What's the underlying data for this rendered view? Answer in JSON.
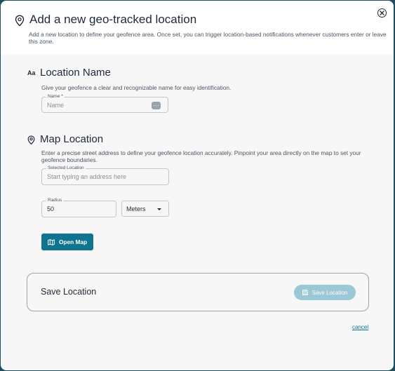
{
  "modal": {
    "title": "Add a new geo-tracked location",
    "description": "Add a new location to define your geofence area. Once set, you can trigger location-based notifications whenever customers enter or leave this zone."
  },
  "location_name": {
    "icon_text": "Aa",
    "title": "Location Name",
    "description": "Give your geofence a clear and recognizable name for easy identification.",
    "name_label": "Name *",
    "name_placeholder": "Name"
  },
  "map_location": {
    "title": "Map Location",
    "description": "Enter a precise street address to define your geofence location accurately. Pinpoint your area directly on the map to set your geofence boundaries.",
    "address_label": "Selected Location",
    "address_placeholder": "Start typing an address here",
    "radius_label": "Radius",
    "radius_value": "50",
    "unit_selected": "Meters",
    "open_map_label": "Open Map"
  },
  "save_panel": {
    "title": "Save Location",
    "button_label": "Save Location"
  },
  "cancel_label": "cancel",
  "colors": {
    "accent": "#0e7490",
    "accent_disabled": "#9cc7d4",
    "backdrop": "#1f4e5f"
  }
}
